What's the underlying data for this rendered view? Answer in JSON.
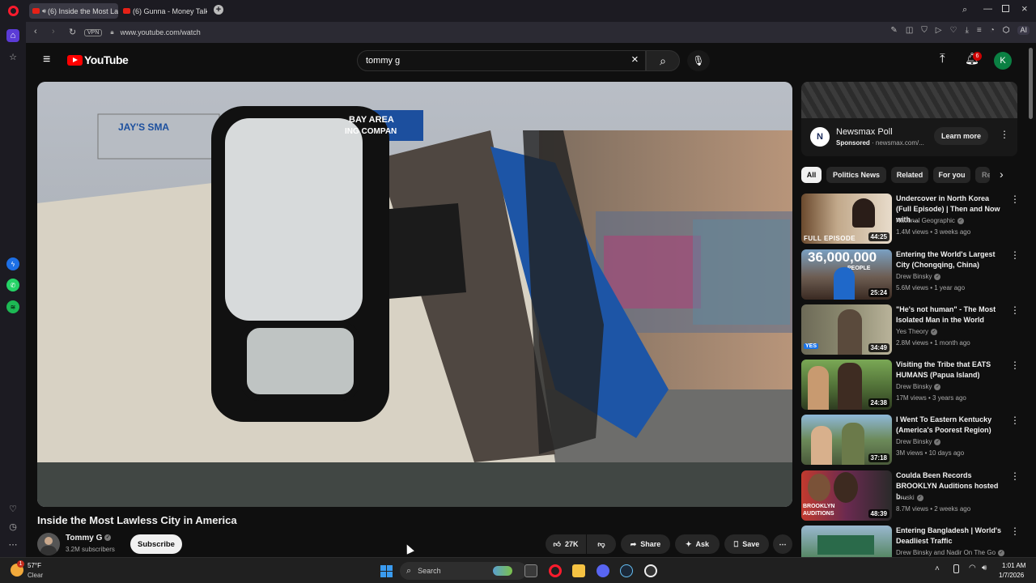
{
  "browser": {
    "tabs": [
      {
        "title": "(6) Inside the Most La"
      },
      {
        "title": "(6) Gunna - Money Talk [M"
      }
    ],
    "url": "www.youtube.com/watch",
    "vpn_label": "VPN",
    "ai_label": "AI"
  },
  "youtube": {
    "logo_text": "YouTube",
    "search_query": "tommy g",
    "notification_count": "6",
    "account_initial": "K"
  },
  "video": {
    "title": "Inside the Most Lawless City in America",
    "channel": "Tommy G",
    "subscribers": "3.2M subscribers",
    "subscribe_label": "Subscribe",
    "likes": "27K",
    "share_label": "Share",
    "ask_label": "Ask",
    "save_label": "Save",
    "sign_text_1": "JAY'S SMA",
    "sign_text_2": "BAY AREA",
    "sign_text_3": "ING COMPAN"
  },
  "ad": {
    "logo_letter": "N",
    "title": "Newsmax Poll",
    "sponsored": "Sponsored",
    "domain": "newsmax.com/...",
    "cta": "Learn more"
  },
  "chips": [
    "All",
    "Politics News",
    "Related",
    "For you",
    "Re"
  ],
  "recommendations": [
    {
      "title": "Undercover in North Korea (Full Episode) | Then and Now with ...",
      "channel": "National Geographic",
      "meta": "1.4M views • 3 weeks ago",
      "duration": "44:25",
      "overlay": "FULL EPISODE"
    },
    {
      "title": "Entering the World's Largest City (Chongqing, China)",
      "channel": "Drew Binsky",
      "meta": "5.6M views • 1 year ago",
      "duration": "25:24",
      "overlay": "36,000,000",
      "overlay2": "PEOPLE"
    },
    {
      "title": "\"He's not human\" - The Most Isolated Man in the World",
      "channel": "Yes Theory",
      "meta": "2.8M views • 1 month ago",
      "duration": "34:49",
      "overlay": "YES"
    },
    {
      "title": "Visiting the Tribe that EATS HUMANS (Papua Island)",
      "channel": "Drew Binsky",
      "meta": "17M views • 3 years ago",
      "duration": "24:38"
    },
    {
      "title": "I Went To Eastern Kentucky (America's Poorest Region)",
      "channel": "Drew Binsky",
      "meta": "3M views • 10 days ago",
      "duration": "37:18"
    },
    {
      "title": "Coulda Been Records BROOKLYN Auditions hosted b...",
      "channel": "Druski",
      "meta": "8.7M views • 2 weeks ago",
      "duration": "48:39",
      "overlay": "BROOKLYN AUDITIONS"
    },
    {
      "title": "Entering Bangladesh | World's Deadliest Traffic",
      "channel": "Drew Binsky and Nadir On The Go",
      "meta": ""
    }
  ],
  "taskbar": {
    "temp": "57°F",
    "weather": "Clear",
    "weather_badge": "1",
    "search_placeholder": "Search",
    "time": "1:01 AM",
    "date": "1/7/2026"
  }
}
